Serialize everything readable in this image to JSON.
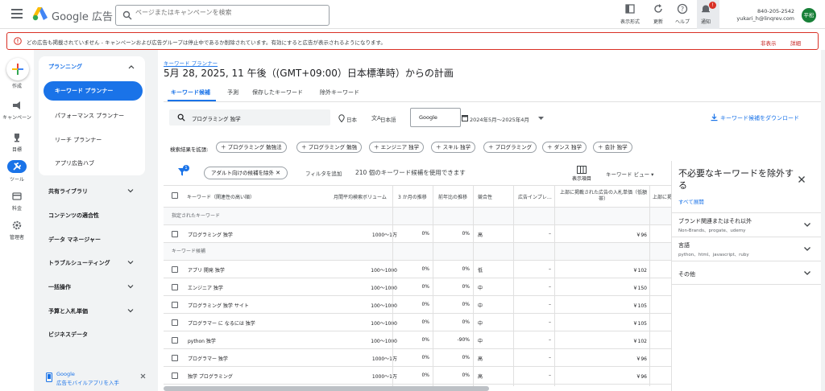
{
  "topbar": {
    "brand": "Google 広告",
    "search_placeholder": "ページまたはキャンペーンを検索",
    "tools": [
      "表示形式",
      "更新",
      "ヘルプ",
      "通知"
    ],
    "notif_count": "!",
    "account_id": "840-205-2542",
    "account_email": "yukari_h@linqrev.com",
    "avatar": "平松"
  },
  "alert": {
    "text": "どの広告も掲載されていません - キャンペーンおよび広告グループは停止中であるか削除されています。有効にすると広告が表示されるようになります。",
    "hide": "非表示",
    "details": "詳細"
  },
  "rail": {
    "create": "作成",
    "items": [
      "キャンペーン",
      "目標",
      "ツール",
      "料金",
      "管理者"
    ]
  },
  "nav": {
    "planning": "プランニング",
    "selected": "キーワード プランナー",
    "subs": [
      "パフォーマンス プランナー",
      "リーチ プランナー",
      "アプリ広告ハブ"
    ],
    "sections": [
      "共有ライブラリ",
      "コンテンツの適合性",
      "データ マネージャー",
      "トラブルシューティング",
      "一括操作",
      "予算と入札単価",
      "ビジネスデータ"
    ],
    "promo_line1": "Google",
    "promo_line2": "広告モバイルアプリを入手"
  },
  "main": {
    "breadcrumb": "キーワード プランナー",
    "title": "5月 28, 2025, 11 午後（(GMT+09:00）日本標準時）からの計画",
    "tabs": [
      "キーワード候補",
      "予測",
      "保存したキーワード",
      "除外キーワード"
    ],
    "keyword": "プログラミング 独学",
    "location": "日本",
    "language": "日本語",
    "network": "Google",
    "date_range": "2024年5月～2025年4月",
    "download": "キーワード候補をダウンロード",
    "refine_label": "検索結果を拡張:",
    "chips": [
      "プログラミング 勉強法",
      "プログラミング 勉強",
      "エンジニア 独学",
      "スキル 独学",
      "プログラミング",
      "ダンス 独学",
      "会計 独学"
    ],
    "filter_badge": "1",
    "adult_filter": "アダルト向けの候補を除外",
    "add_filter": "フィルタを追加",
    "available": "210 個のキーワード候補を使用できます",
    "columns_label": "表示項目",
    "view": "キーワード ビュー"
  },
  "table": {
    "headers": [
      "キーワード（関連性の高い順）",
      "月間平均検索ボリューム",
      "3 か月の推移",
      "前年比の推移",
      "競合性",
      "広告インプレ…",
      "上部に掲載された広告の入札単価（低額帯）",
      "上部に掲"
    ],
    "group1": "指定されたキーワード",
    "group2": "キーワード候補",
    "specified": [
      {
        "kw": "プログラミング 独学",
        "vol": "1000～1万",
        "m3": "0%",
        "yoy": "0%",
        "comp": "高",
        "imp": "–",
        "bid": "￥96"
      }
    ],
    "rows": [
      {
        "kw": "アプリ 開発 独学",
        "vol": "100～1000",
        "m3": "0%",
        "yoy": "0%",
        "comp": "低",
        "imp": "–",
        "bid": "￥102"
      },
      {
        "kw": "エンジニア 独学",
        "vol": "100～1000",
        "m3": "0%",
        "yoy": "0%",
        "comp": "中",
        "imp": "–",
        "bid": "￥150"
      },
      {
        "kw": "プログラミング 独学 サイト",
        "vol": "100～1000",
        "m3": "0%",
        "yoy": "0%",
        "comp": "中",
        "imp": "–",
        "bid": "￥105"
      },
      {
        "kw": "プログラマー に なるには 独学",
        "vol": "100～1000",
        "m3": "0%",
        "yoy": "0%",
        "comp": "中",
        "imp": "–",
        "bid": "￥105"
      },
      {
        "kw": "python 独学",
        "vol": "100～1000",
        "m3": "0%",
        "yoy": "-90%",
        "comp": "中",
        "imp": "–",
        "bid": "￥102"
      },
      {
        "kw": "プログラマー 独学",
        "vol": "1000～1万",
        "m3": "0%",
        "yoy": "0%",
        "comp": "高",
        "imp": "–",
        "bid": "￥96"
      },
      {
        "kw": "独学 プログラミング",
        "vol": "1000～1万",
        "m3": "0%",
        "yoy": "0%",
        "comp": "高",
        "imp": "–",
        "bid": "￥96"
      }
    ]
  },
  "panel": {
    "title": "不必要なキーワードを除外する",
    "expand_all": "すべて展開",
    "sections": [
      {
        "title": "ブランド関連またはそれ以外",
        "sub": "Non-Brands、progate、udemy"
      },
      {
        "title": "言語",
        "sub": "python、html、javascript、ruby"
      },
      {
        "title": "その他",
        "sub": ""
      }
    ]
  }
}
